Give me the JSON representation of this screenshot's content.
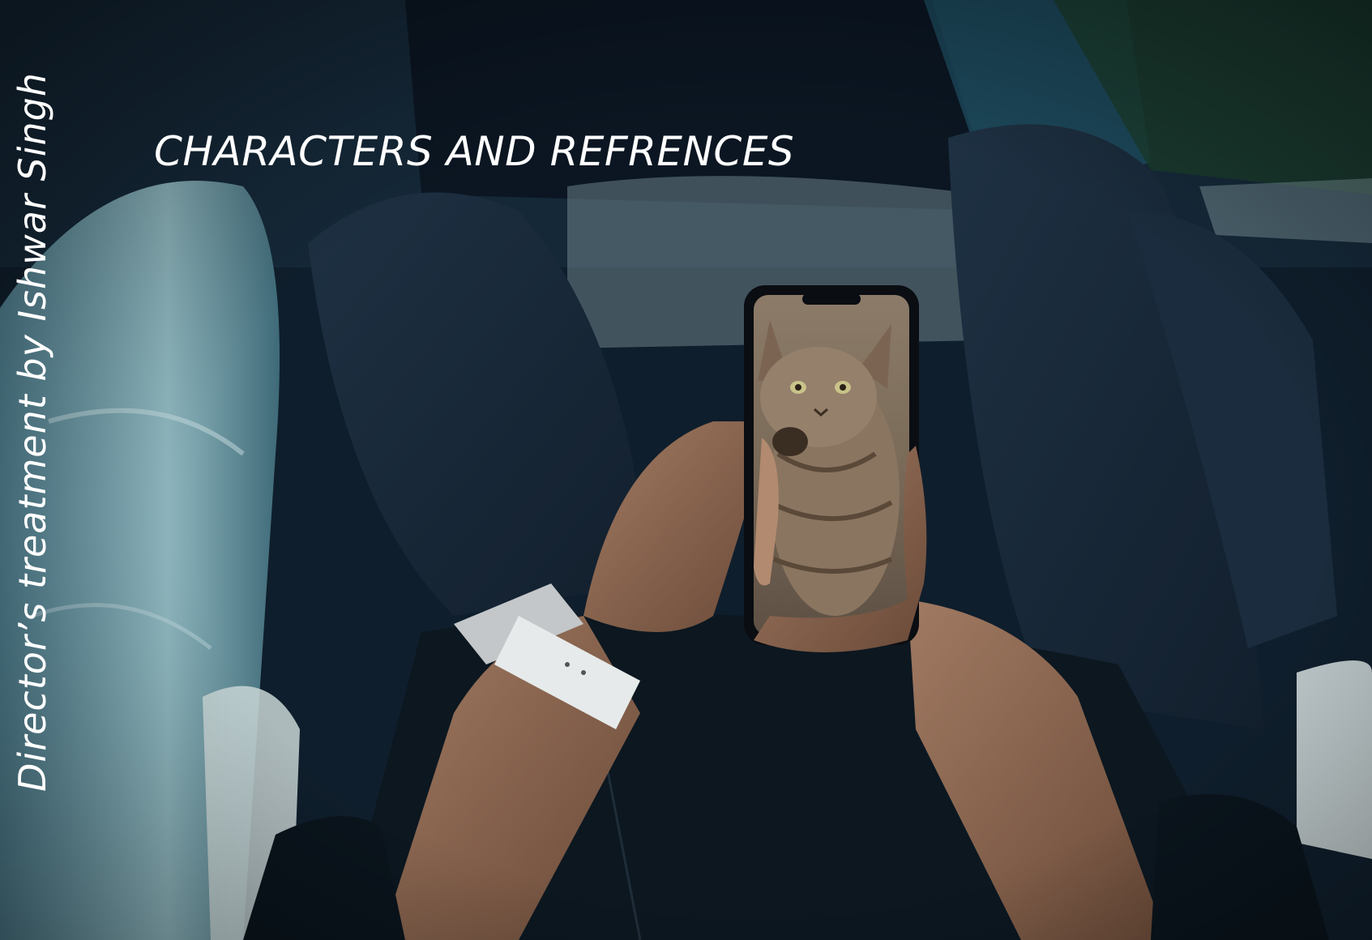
{
  "slide": {
    "side_title": "Director’s treatment by Ishwar Singh",
    "section_title": "CHARACTERS AND REFRENCES"
  },
  "photo": {
    "subject": "kitten-on-phone-screen"
  },
  "colors": {
    "text": "#ffffff",
    "background": "#0e1c29"
  }
}
